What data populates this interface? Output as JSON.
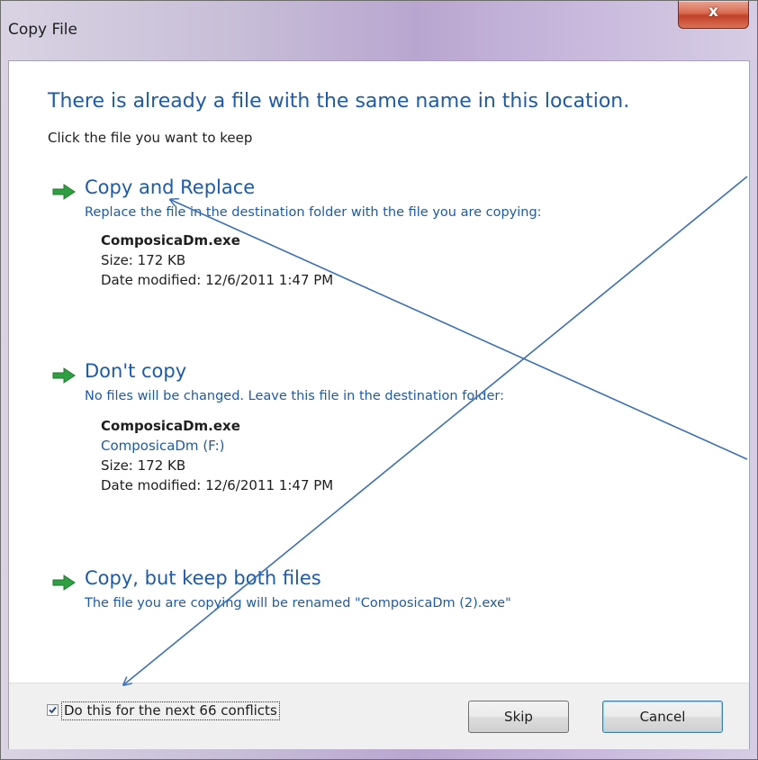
{
  "window": {
    "title": "Copy File",
    "close_symbol": "x",
    "colors": {
      "titlebar": "#c8bfd8",
      "heading_blue": "#1e5aa8",
      "close_red": "#c1402a",
      "arrow_green": "#2ea042",
      "annotation_blue": "#3b6fb6"
    }
  },
  "dialog": {
    "heading": "There is already a file with the same name in this location.",
    "subheading": "Click the file you want to keep",
    "options": [
      {
        "icon": "green-arrow-icon",
        "title": "Copy and Replace",
        "description": "Replace the file in the destination folder with the file you are copying:",
        "file_name": "ComposicaDm.exe",
        "size": "Size: 172 KB",
        "date": "Date modified: 12/6/2011 1:47 PM"
      },
      {
        "icon": "green-arrow-icon",
        "title": "Don't copy",
        "description": "No files will be changed. Leave this file in the destination folder:",
        "file_name": "ComposicaDm.exe",
        "location": "ComposicaDm (F:)",
        "size": "Size: 172 KB",
        "date": "Date modified: 12/6/2011 1:47 PM"
      },
      {
        "icon": "green-arrow-icon",
        "title": "Copy, but keep both files",
        "description": "The file you are copying will be renamed \"ComposicaDm (2).exe\""
      }
    ]
  },
  "footer": {
    "checkbox_label": "Do this for the next 66 conflicts",
    "checkbox_checked": true,
    "skip_label": "Skip",
    "cancel_label": "Cancel"
  }
}
